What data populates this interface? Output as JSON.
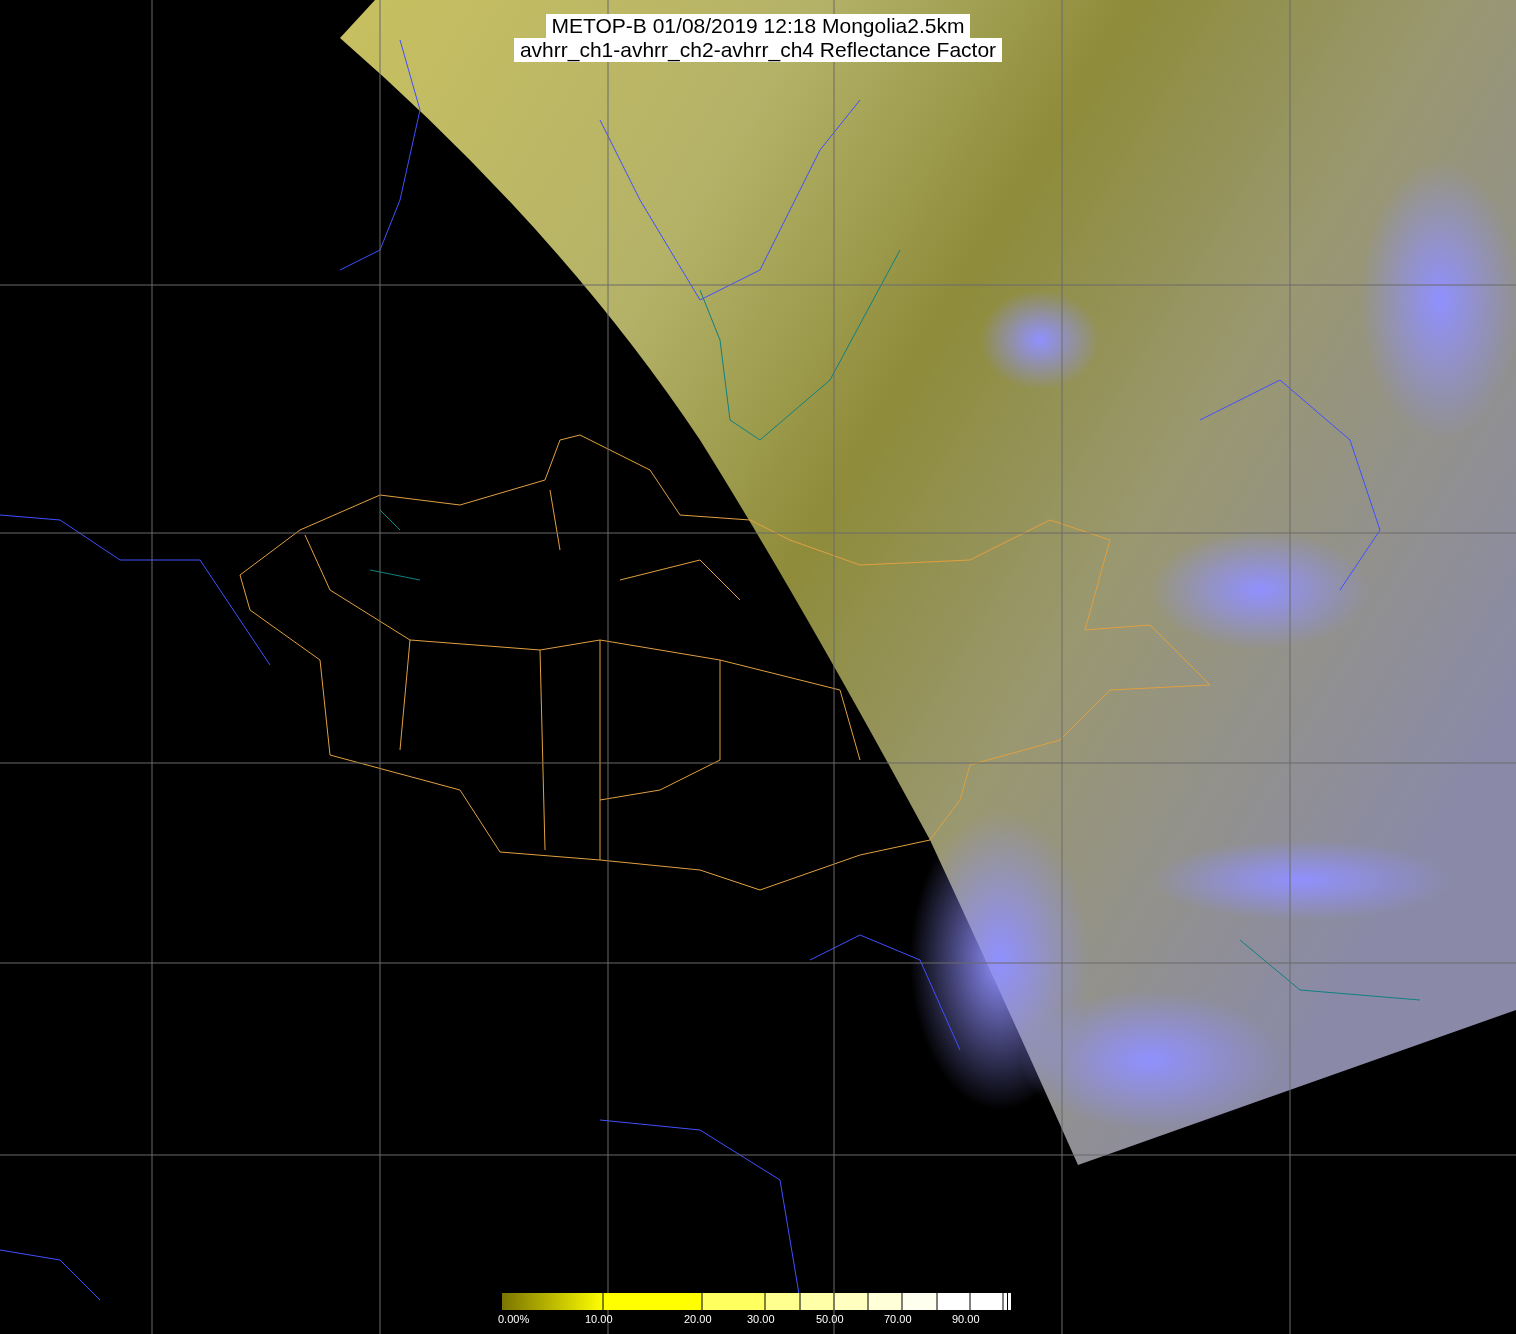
{
  "title": {
    "lines": [
      "METOP-B 01/08/2019 12:18 Mongolia2.5km",
      "avhrr_ch1-avhrr_ch2-avhrr_ch4 Reflectance Factor"
    ]
  },
  "colorbar": {
    "labels": [
      "0.00%",
      "10.00",
      "20.00",
      "30.00",
      "50.00",
      "70.00",
      "90.00"
    ]
  }
}
